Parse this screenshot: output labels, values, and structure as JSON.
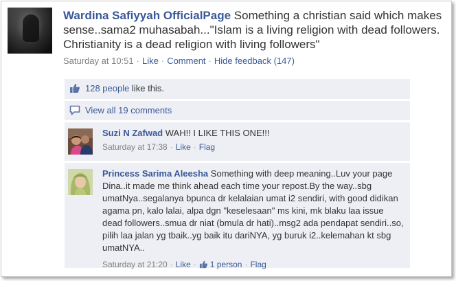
{
  "post": {
    "author": "Wardina Safiyyah OfficialPage",
    "text": "Something a christian said which makes sense..sama2 muhasabah...\"Islam is a living religion with dead followers. Christianity is a dead religion with living followers\"",
    "timestamp": "Saturday at 10:51",
    "like_label": "Like",
    "comment_label": "Comment",
    "hide_feedback_label": "Hide feedback (147)"
  },
  "likes": {
    "count_label": "128 people",
    "suffix": "like this."
  },
  "view_all": {
    "label": "View all 19 comments"
  },
  "comments": [
    {
      "name": "Suzi N Zafwad",
      "text": "WAH!! I LIKE THIS ONE!!!",
      "timestamp": "Saturday at 17:38",
      "like_label": "Like",
      "flag_label": "Flag"
    },
    {
      "name": "Princess Sarima Aleesha",
      "text": "Something with deep meaning..Luv your page Dina..it made me think ahead each time your repost.By the way..sbg umatNya..segalanya bpunca dr kelalaian umat i2 sendiri, with good didikan agama pn, kalo lalai, alpa dgn \"keselesaan\" ms kini, mk blaku laa issue dead followers..smua dr niat (bmula dr hati)..msg2 ada pendapat sendiri..so, pilih laa jalan yg tbaik..yg baik itu dariNYA, yg buruk i2..kelemahan kt sbg umatNYA..",
      "timestamp": "Saturday at 21:20",
      "like_label": "Like",
      "likes_count": "1 person",
      "flag_label": "Flag"
    }
  ],
  "colors": {
    "link": "#3b5998",
    "meta": "#808080",
    "panel": "#edeff4"
  }
}
